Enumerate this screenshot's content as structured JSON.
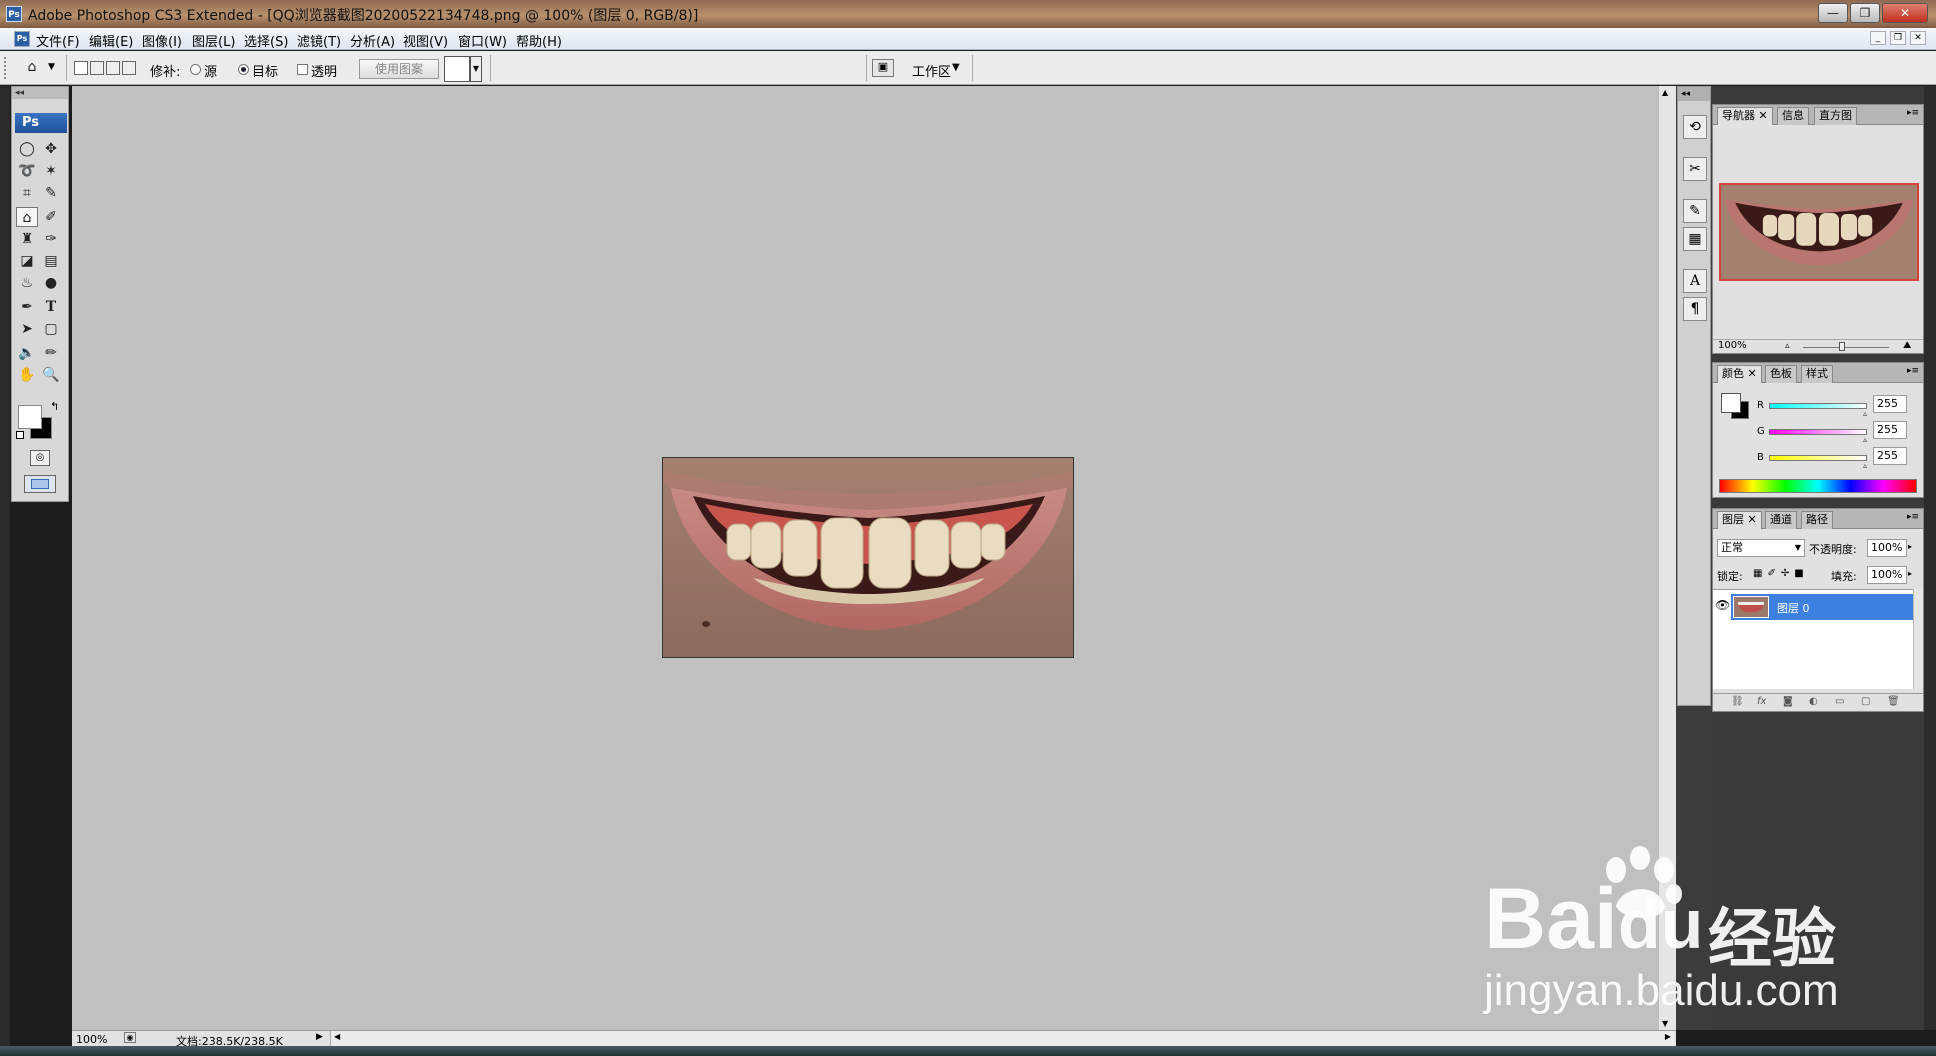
{
  "window": {
    "title": "Adobe Photoshop CS3 Extended - [QQ浏览器截图20200522134748.png @ 100% (图层 0, RGB/8)]",
    "app_icon": "Ps"
  },
  "menu": [
    "文件(F)",
    "编辑(E)",
    "图像(I)",
    "图层(L)",
    "选择(S)",
    "滤镜(T)",
    "分析(A)",
    "视图(V)",
    "窗口(W)",
    "帮助(H)"
  ],
  "options": {
    "patch_label": "修补:",
    "source_label": "源",
    "dest_label": "目标",
    "transparent_label": "透明",
    "use_pattern_label": "使用图案",
    "workspace_label": "工作区",
    "selected_mode": "目标"
  },
  "toolbox": {
    "logo": "Ps"
  },
  "panels": {
    "navigator": {
      "tabs": [
        "导航器",
        "信息",
        "直方图"
      ],
      "zoom": "100%"
    },
    "color": {
      "tabs": [
        "颜色",
        "色板",
        "样式"
      ],
      "channels": [
        {
          "label": "R",
          "value": "255",
          "color": "#22d6d6"
        },
        {
          "label": "G",
          "value": "255",
          "color": "#e030d8"
        },
        {
          "label": "B",
          "value": "255",
          "color": "#e8e820"
        }
      ]
    },
    "layers": {
      "tabs": [
        "图层",
        "通道",
        "路径"
      ],
      "blend_mode": "正常",
      "opacity_label": "不透明度:",
      "opacity_value": "100%",
      "lock_label": "锁定:",
      "fill_label": "填充:",
      "fill_value": "100%",
      "layer_name": "图层 0"
    }
  },
  "status": {
    "zoom": "100%",
    "doc_info": "文档:238.5K/238.5K"
  },
  "watermark": {
    "brand": "Bai",
    "brand2": "du",
    "jingyan": "经验",
    "url": "jingyan.baidu.com"
  }
}
